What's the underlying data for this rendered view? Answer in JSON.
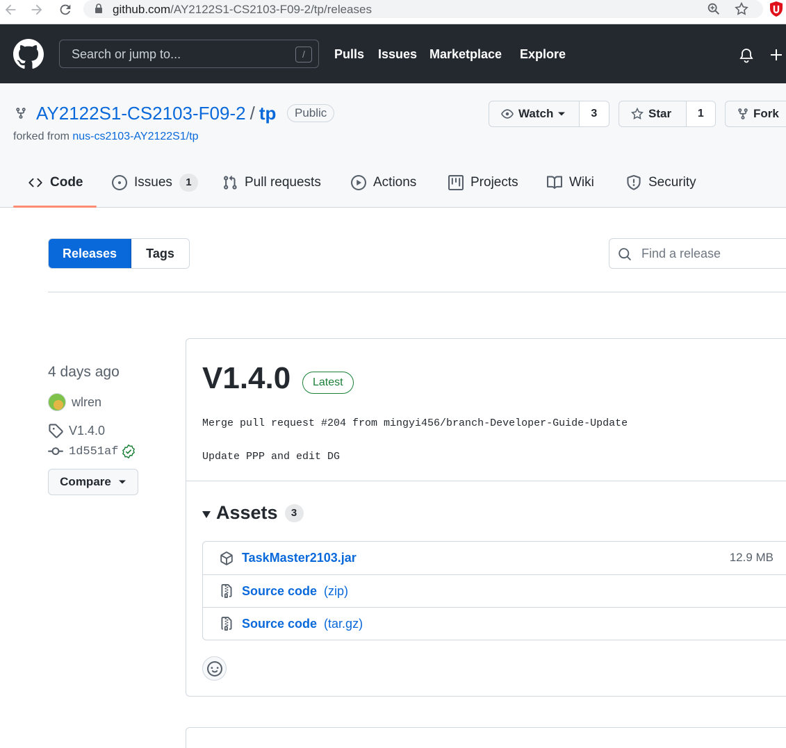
{
  "browser": {
    "url_host": "github.com",
    "url_path": "/AY2122S1-CS2103-F09-2/tp/releases",
    "icons": [
      "back-arrow-icon",
      "forward-arrow-icon",
      "reload-icon",
      "lock-icon",
      "zoom-icon",
      "bookmark-star-icon",
      "extension-shield-icon"
    ]
  },
  "header": {
    "search_placeholder": "Search or jump to...",
    "search_shortcut": "/",
    "nav": [
      "Pulls",
      "Issues",
      "Marketplace",
      "Explore"
    ],
    "icons": [
      "github-logo-icon",
      "bell-icon",
      "plus-icon"
    ]
  },
  "repo": {
    "owner": "AY2122S1-CS2103-F09-2",
    "separator": "/",
    "name": "tp",
    "visibility": "Public",
    "forked_prefix": "forked from",
    "forked_from": "nus-cs2103-AY2122S1/tp",
    "watch": {
      "label": "Watch",
      "count": "3"
    },
    "star": {
      "label": "Star",
      "count": "1"
    },
    "fork": {
      "label": "Fork"
    }
  },
  "tabs": [
    {
      "label": "Code",
      "icon": "code-icon",
      "active": true
    },
    {
      "label": "Issues",
      "icon": "issue-icon",
      "count": "1"
    },
    {
      "label": "Pull requests",
      "icon": "pull-request-icon"
    },
    {
      "label": "Actions",
      "icon": "play-icon"
    },
    {
      "label": "Projects",
      "icon": "project-icon"
    },
    {
      "label": "Wiki",
      "icon": "book-icon"
    },
    {
      "label": "Security",
      "icon": "shield-icon"
    }
  ],
  "releases_toolbar": {
    "releases_label": "Releases",
    "tags_label": "Tags",
    "find_placeholder": "Find a release"
  },
  "release": {
    "time": "4 days ago",
    "author": "wlren",
    "tag": "V1.4.0",
    "commit": "1d551af",
    "compare_label": "Compare",
    "title": "V1.4.0",
    "badge": "Latest",
    "message_line1": "Merge pull request #204 from mingyi456/branch-Developer-Guide-Update",
    "message_line2": "Update PPP and edit DG",
    "assets_label": "Assets",
    "assets_count": "3",
    "assets": [
      {
        "name": "TaskMaster2103.jar",
        "ext": "",
        "size": "12.9 MB",
        "icon": "package-icon"
      },
      {
        "name": "Source code",
        "ext": "(zip)",
        "size": "",
        "icon": "file-zip-icon"
      },
      {
        "name": "Source code",
        "ext": "(tar.gz)",
        "size": "",
        "icon": "file-zip-icon"
      }
    ]
  },
  "colors": {
    "accent": "#0969da",
    "header_bg": "#24292f",
    "latest_green": "#1a7f37",
    "tab_underline": "#fd8c73"
  }
}
